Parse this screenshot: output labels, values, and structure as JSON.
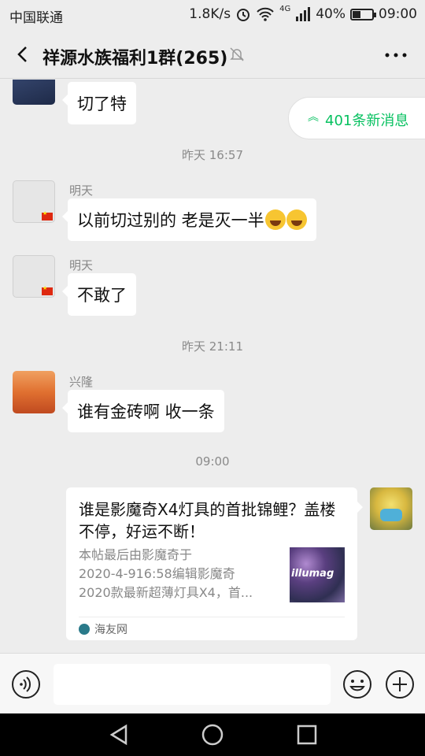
{
  "status_bar": {
    "carrier": "中国联通",
    "speed": "1.8K/s",
    "network": "4G",
    "battery": "40%",
    "battery_level": 0.4,
    "time": "09:00"
  },
  "header": {
    "title": "祥源水族福利1群(265)"
  },
  "new_messages": {
    "label": "401条新消息"
  },
  "messages": [
    {
      "sender": "",
      "text": "切了特"
    },
    {
      "type": "time",
      "text": "昨天 16:57"
    },
    {
      "sender": "明天",
      "text": "以前切过别的  老是灭一半"
    },
    {
      "sender": "明天",
      "text": "不敢了"
    },
    {
      "type": "time",
      "text": "昨天 21:11"
    },
    {
      "sender": "兴隆",
      "text": "谁有金砖啊 收一条"
    },
    {
      "type": "time",
      "text": "09:00"
    }
  ],
  "link_card": {
    "title": "谁是影魔奇X4灯具的首批锦鲤？盖楼不停，好运不断！",
    "desc_lines": [
      "本帖最后由影魔奇于",
      "2020-4-916:58编辑影魔奇",
      "2020款最新超薄灯具X4，首..."
    ],
    "thumb_text": "illumag",
    "source": "海友网"
  },
  "colors": {
    "accent": "#07c160",
    "background": "#ededed",
    "bubble": "#ffffff"
  }
}
